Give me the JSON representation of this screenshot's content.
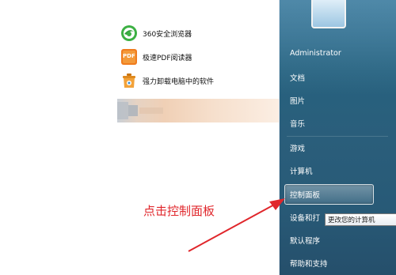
{
  "programs": [
    {
      "label": "360安全浏览器",
      "icon": "360-browser-icon"
    },
    {
      "label": "极速PDF阅读器",
      "icon": "pdf-reader-icon"
    },
    {
      "label": "强力卸载电脑中的软件",
      "icon": "uninstaller-icon"
    }
  ],
  "pdf_icon_text": "PDF",
  "right_menu": {
    "username": "Administrator",
    "items": [
      "文档",
      "图片",
      "音乐",
      "游戏",
      "计算机",
      "控制面板",
      "设备和打",
      "默认程序",
      "帮助和支持"
    ]
  },
  "tooltip": "更改您的计算机",
  "annotation": "点击控制面板",
  "colors": {
    "annotation": "#e0262b",
    "panel_blue": "#27627f",
    "arrow": "#e0262b"
  }
}
